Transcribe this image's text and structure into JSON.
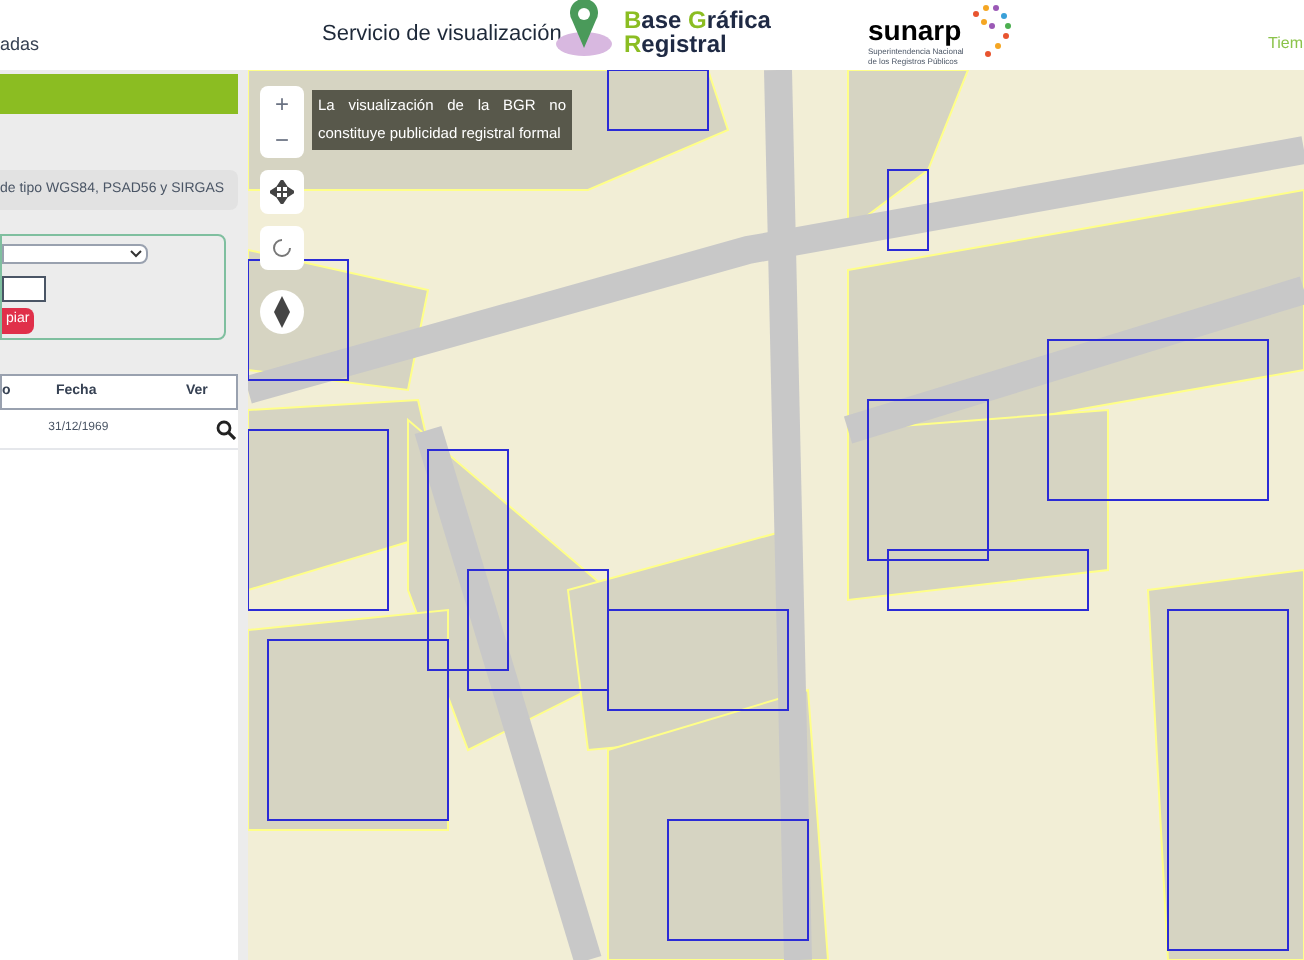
{
  "header": {
    "left_text": "adas",
    "service_title": "Servicio de visualización",
    "logo_words": [
      "Base",
      "Gráfica",
      "Registral"
    ],
    "sunarp_name": "sunarp",
    "sunarp_subtitle": "Superintendencia Nacional de los Registros Públicos",
    "right_text": "Tiem"
  },
  "sidebar": {
    "hint": "de tipo WGS84, PSAD56 y SIRGAS",
    "clear_button": "piar",
    "table": {
      "columns": [
        "o",
        "Fecha",
        "Ver"
      ],
      "rows": [
        {
          "date": "31/12/1969"
        }
      ]
    }
  },
  "map": {
    "notice": "La visualización de la BGR no constituye publicidad registral formal",
    "zoom_in": "+",
    "zoom_out": "−"
  }
}
